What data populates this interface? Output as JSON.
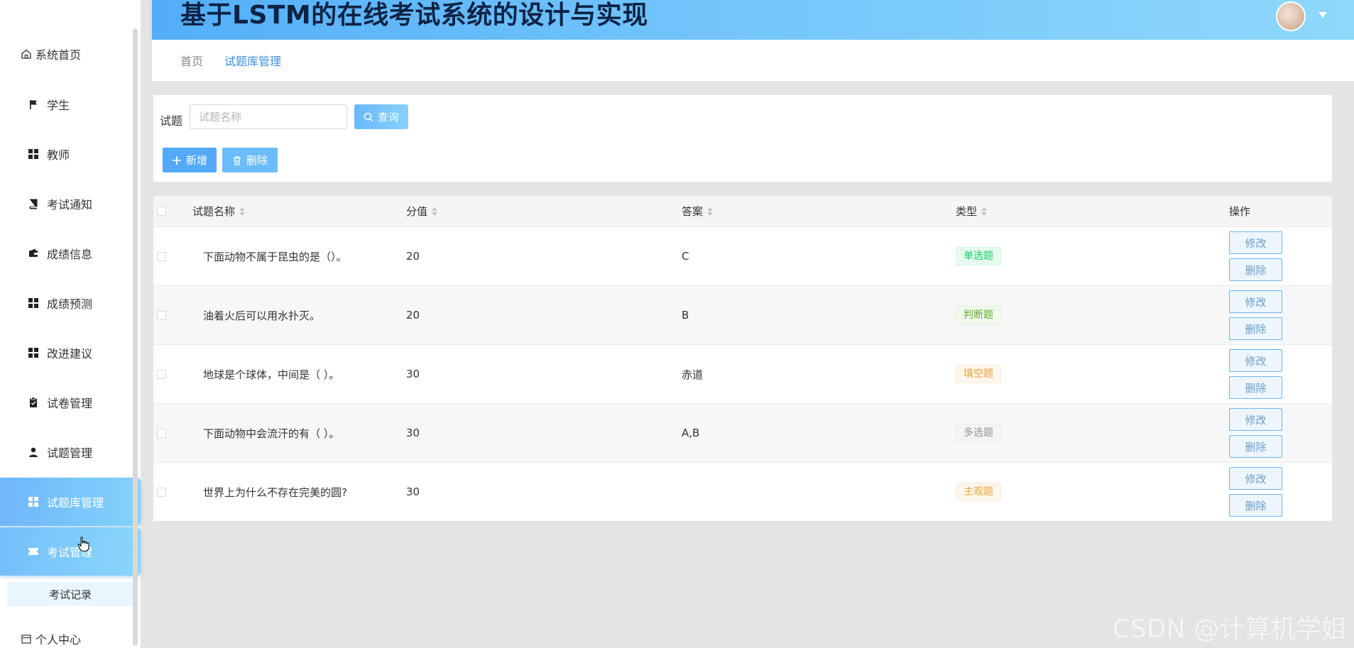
{
  "header": {
    "title": "基于LSTM的在线考试系统的设计与实现"
  },
  "sidebar": {
    "items": [
      {
        "label": "系统首页",
        "icon": "home-icon"
      },
      {
        "label": "学生",
        "icon": "flag-icon"
      },
      {
        "label": "教师",
        "icon": "grid-icon"
      },
      {
        "label": "考试通知",
        "icon": "book-icon"
      },
      {
        "label": "成绩信息",
        "icon": "wallet-icon"
      },
      {
        "label": "成绩预测",
        "icon": "grid-icon"
      },
      {
        "label": "改进建议",
        "icon": "grid-icon"
      },
      {
        "label": "试卷管理",
        "icon": "clipboard-icon"
      },
      {
        "label": "试题管理",
        "icon": "user-icon"
      },
      {
        "label": "试题库管理",
        "icon": "grid-icon"
      },
      {
        "label": "考试管理",
        "icon": "ticket-icon"
      },
      {
        "label": "个人中心",
        "icon": "calendar-icon"
      }
    ],
    "sub_item": "考试记录"
  },
  "breadcrumb": {
    "home": "首页",
    "current": "试题库管理"
  },
  "search": {
    "label": "试题",
    "placeholder": "试题名称",
    "query_label": "查询"
  },
  "actions": {
    "add_label": "新增",
    "delete_label": "删除"
  },
  "table": {
    "headers": [
      "试题名称",
      "分值",
      "答案",
      "类型",
      "操作"
    ],
    "rows": [
      {
        "name": "下面动物不属于昆虫的是（）。",
        "score": "20",
        "answer": "C",
        "type": "单选题",
        "type_color": "green"
      },
      {
        "name": "油着火后可以用水扑灭。",
        "score": "20",
        "answer": "B",
        "type": "判断题",
        "type_color": "lime"
      },
      {
        "name": "地球是个球体，中间是（ ）。",
        "score": "30",
        "answer": "赤道",
        "type": "填空题",
        "type_color": "orange"
      },
      {
        "name": "下面动物中会流汗的有（ ）。",
        "score": "30",
        "answer": "A,B",
        "type": "多选题",
        "type_color": "gray"
      },
      {
        "name": "世界上为什么不存在完美的圆?",
        "score": "30",
        "answer": "",
        "type": "主观题",
        "type_color": "orange"
      }
    ],
    "edit_label": "修改",
    "delete_label": "删除"
  },
  "watermark": "CSDN @计算机学姐"
}
